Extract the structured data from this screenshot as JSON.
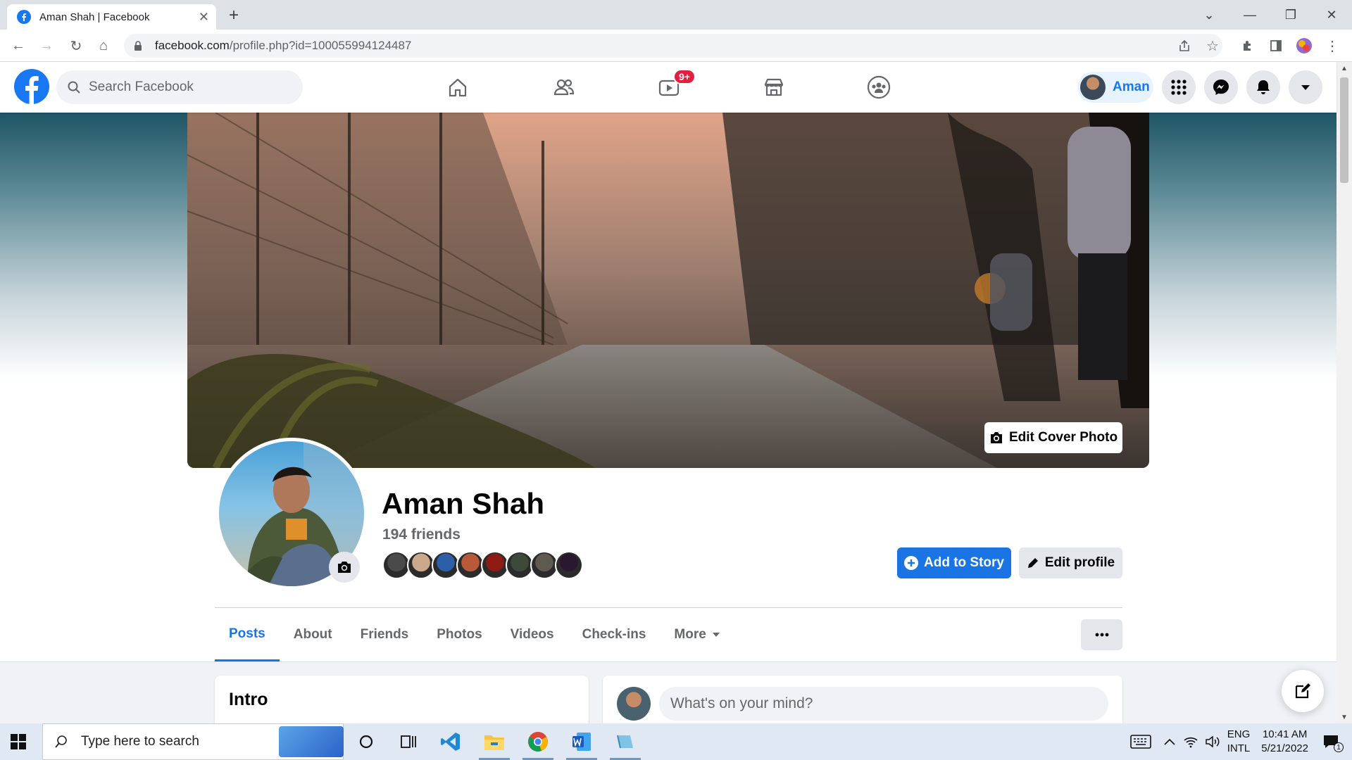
{
  "browser": {
    "tab_title": "Aman Shah | Facebook",
    "url_host": "facebook.com",
    "url_path": "/profile.php?id=100055994124487"
  },
  "header": {
    "search_placeholder": "Search Facebook",
    "watch_badge": "9+",
    "user_name": "Aman",
    "icons": [
      "home-icon",
      "friends-icon",
      "watch-icon",
      "marketplace-icon",
      "groups-icon",
      "menu-grid-icon",
      "messenger-icon",
      "notifications-icon",
      "account-caret-icon"
    ]
  },
  "profile": {
    "edit_cover_label": "Edit Cover Photo",
    "name": "Aman Shah",
    "friend_count": "194 friends",
    "friend_avatar_colors": [
      "#4a4a4a",
      "#c9a98a",
      "#2c5fa8",
      "#b85a3a",
      "#8f1a14",
      "#3d4a3a",
      "#5e5a50",
      "#2a1830"
    ],
    "add_story_label": "Add to Story",
    "edit_profile_label": "Edit profile",
    "tabs": [
      "Posts",
      "About",
      "Friends",
      "Photos",
      "Videos",
      "Check-ins",
      "More"
    ]
  },
  "feed": {
    "intro_title": "Intro",
    "composer_placeholder": "What's on your mind?"
  },
  "taskbar": {
    "search_placeholder": "Type here to search",
    "lang_line1": "ENG",
    "lang_line2": "INTL",
    "time": "10:41 AM",
    "date": "5/21/2022",
    "notification_count": "1"
  },
  "colors": {
    "facebook_blue": "#1877f2",
    "badge_red": "#e41e3f",
    "accent_button": "#1b74e4"
  }
}
